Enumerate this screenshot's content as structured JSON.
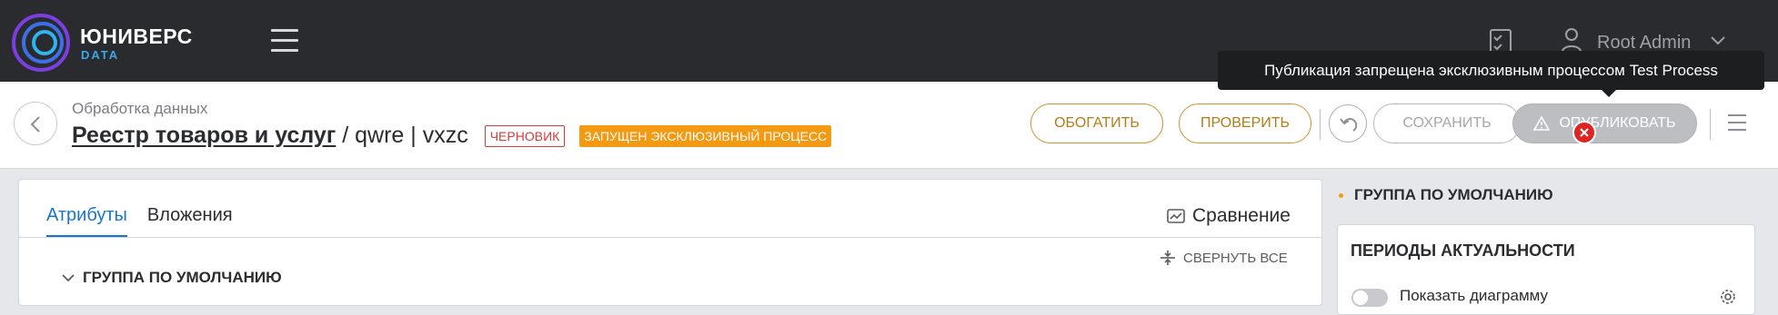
{
  "app": {
    "brand": "ЮНИВЕРС",
    "brand_sub": "DATA",
    "user_name": "Root Admin"
  },
  "header": {
    "breadcrumb": "Обработка данных",
    "title_link": "Реестр товаров и услуг",
    "title_rest": "/ qwre | vxzc",
    "badge_draft": "ЧЕРНОВИК",
    "badge_process": "ЗАПУЩЕН ЭКСКЛЮЗИВНЫЙ ПРОЦЕСС",
    "btn_enrich": "ОБОГАТИТЬ",
    "btn_check": "ПРОВЕРИТЬ",
    "btn_save": "СОХРАНИТЬ",
    "btn_publish": "ОПУБЛИКОВАТЬ"
  },
  "tooltip": {
    "text": "Публикация запрещена эксклюзивным процессом Test Process"
  },
  "main": {
    "tabs": [
      {
        "label": "Атрибуты",
        "active": true
      },
      {
        "label": "Вложения",
        "active": false
      }
    ],
    "compare_label": "Сравнение",
    "collapse_label": "СВЕРНУТЬ ВСЕ",
    "group_label": "ГРУППА ПО УМОЛЧАНИЮ"
  },
  "right_panel": {
    "group_title": "ГРУППА ПО УМОЛЧАНИЮ",
    "card_title": "ПЕРИОДЫ АКТУАЛЬНОСТИ",
    "toggle_label": "Показать диаграмму"
  },
  "colors": {
    "accent": "#1976c6",
    "warning": "#f49a12",
    "error": "#e02323",
    "gold": "#c9962c"
  }
}
